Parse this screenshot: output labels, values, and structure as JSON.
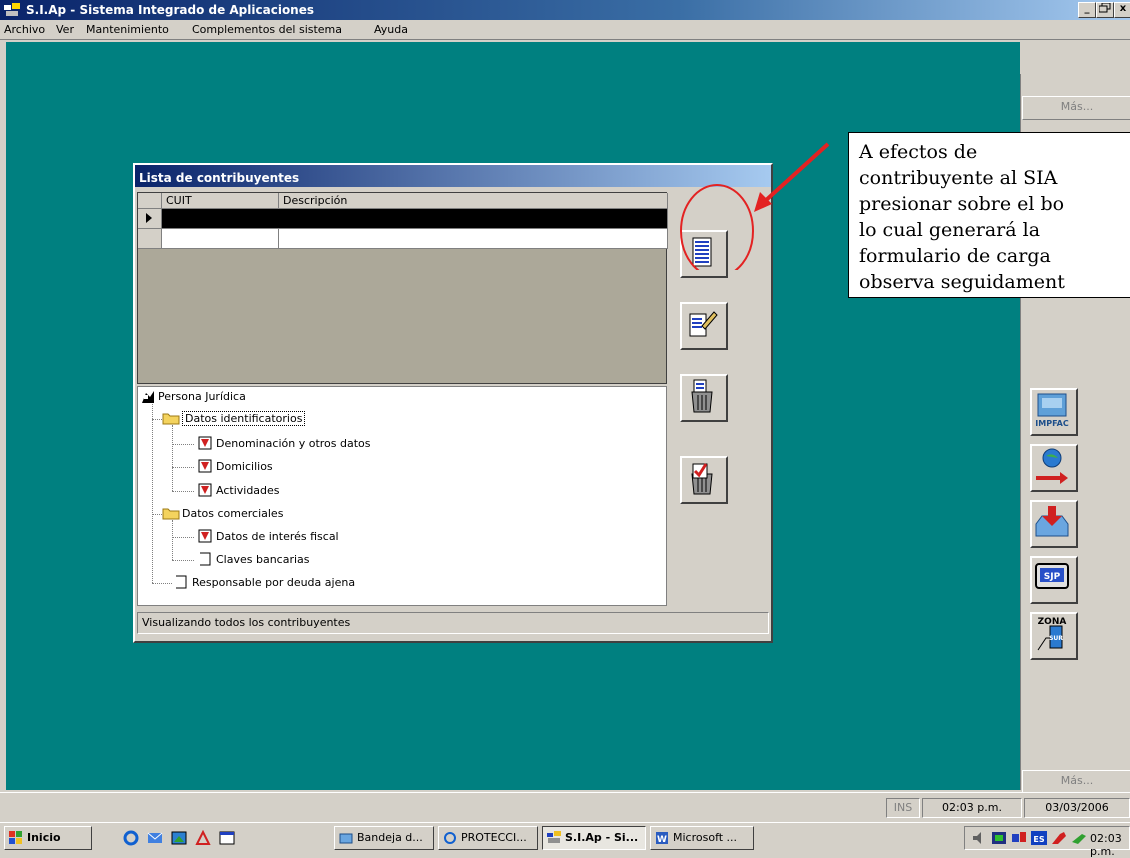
{
  "window": {
    "title": "S.I.Ap - Sistema Integrado de Aplicaciones",
    "min_label": "_",
    "max_label": "̸",
    "close_label": "x"
  },
  "menu": [
    "Archivo",
    "Ver",
    "Mantenimiento",
    "Complementos del sistema",
    "Ayuda"
  ],
  "right_toolbar": {
    "more_top": "Más...",
    "more_bottom": "Más...",
    "icons": [
      "impfac-icon",
      "globe-transfer-icon",
      "inbox-download-icon",
      "sjp-icon",
      "zona-sur-icon"
    ],
    "impfac_label": "IMPFAC",
    "sjp_label": "SJP",
    "zona_label": "ZONA",
    "sur_label": "SUR"
  },
  "dialog": {
    "title": "Lista de contribuyentes",
    "columns": [
      "CUIT",
      "Descripción"
    ],
    "status": "Visualizando todos los contribuyentes",
    "tree": {
      "root": "Persona Jurídica",
      "group1": "Datos identificatorios",
      "group1_items": [
        "Denominación y otros datos",
        "Domicilios",
        "Actividades"
      ],
      "group2": "Datos comerciales",
      "group2_items": [
        "Datos de interés fiscal",
        "Claves bancarias"
      ],
      "other": "Responsable por deuda ajena"
    }
  },
  "callout": {
    "lines": [
      "A      efectos      de",
      "contribuyente al SIA",
      "presionar sobre el bo",
      "lo cual generará la",
      "formulario de carga",
      "observa seguidament"
    ]
  },
  "status_bar": {
    "ins": "INS",
    "time": "02:03 p.m.",
    "date": "03/03/2006"
  },
  "taskbar": {
    "start": "Inicio",
    "items": [
      "Bandeja d...",
      "PROTECCI...",
      "S.I.Ap - Si...",
      "Microsoft ..."
    ],
    "clock": "02:03 p.m."
  },
  "colors": {
    "desktop": "#008080",
    "title_gradient_start": "#0a246a",
    "highlight": "#e32222"
  }
}
